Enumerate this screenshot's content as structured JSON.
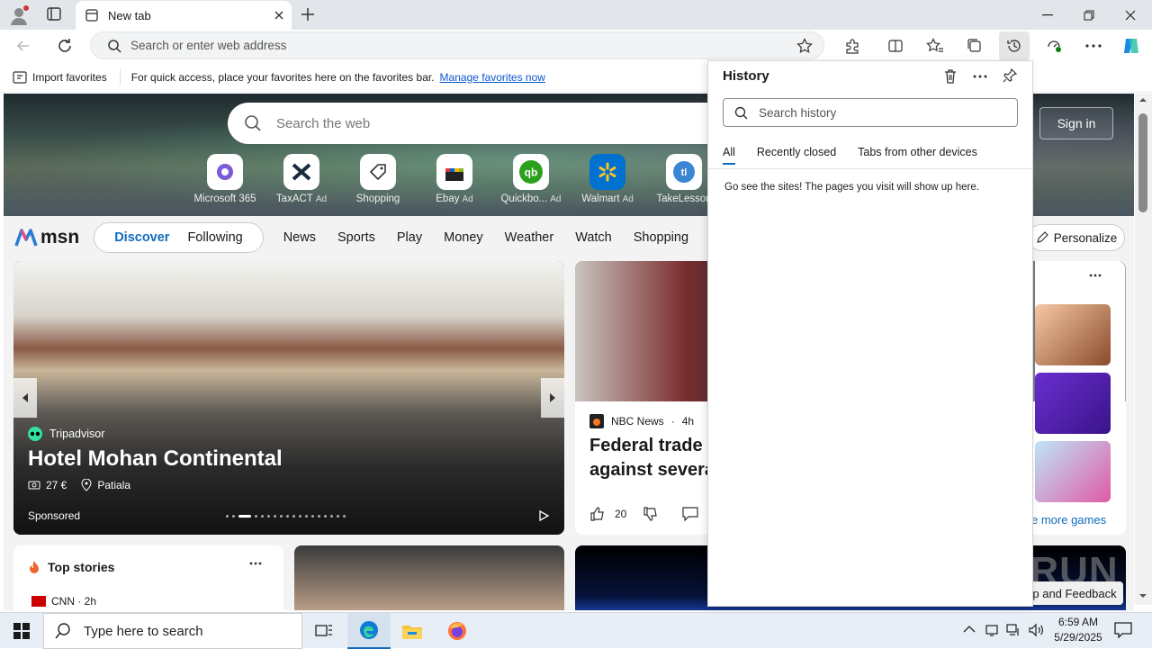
{
  "browser": {
    "tab_title": "New tab",
    "address_placeholder": "Search or enter web address"
  },
  "favorites_bar": {
    "import_label": "Import favorites",
    "message": "For quick access, place your favorites here on the favorites bar.",
    "link": "Manage favorites now"
  },
  "new_tab": {
    "search_placeholder": "Search the web",
    "sign_in": "Sign in",
    "quick_links": [
      {
        "label": "Microsoft 365",
        "ad": ""
      },
      {
        "label": "TaxACT",
        "ad": "Ad"
      },
      {
        "label": "Shopping",
        "ad": ""
      },
      {
        "label": "Ebay",
        "ad": "Ad"
      },
      {
        "label": "Quickbo...",
        "ad": "Ad"
      },
      {
        "label": "Walmart",
        "ad": "Ad"
      },
      {
        "label": "TakeLesson",
        "ad": ""
      }
    ],
    "msn_logo": "msn",
    "feed_tabs": [
      "Discover",
      "Following"
    ],
    "nav_items": [
      "News",
      "Sports",
      "Play",
      "Money",
      "Weather",
      "Watch",
      "Shopping"
    ],
    "personalize": "Personalize",
    "big_card": {
      "source": "Tripadvisor",
      "title": "Hotel Mohan Continental",
      "price": "27 €",
      "location": "Patiala",
      "sponsored": "Sponsored"
    },
    "news_card": {
      "source": "NBC News",
      "age": "4h",
      "title_line1": "Federal trade c",
      "title_line2": "against several",
      "likes": "20"
    },
    "games_more": "e more games",
    "top_stories": {
      "title": "Top stories",
      "first_source": "CNN · 2h"
    },
    "feedback": "p and Feedback",
    "watermark": "ANY RUN"
  },
  "history_panel": {
    "title": "History",
    "search_placeholder": "Search history",
    "tabs": [
      "All",
      "Recently closed",
      "Tabs from other devices"
    ],
    "empty_message": "Go see the sites! The pages you visit will show up here."
  },
  "taskbar": {
    "search_placeholder": "Type here to search",
    "time": "6:59 AM",
    "date": "5/29/2025"
  },
  "colors": {
    "accent": "#0f6cbd",
    "link": "#0b57d0",
    "taskbar": "#e8eef6"
  }
}
